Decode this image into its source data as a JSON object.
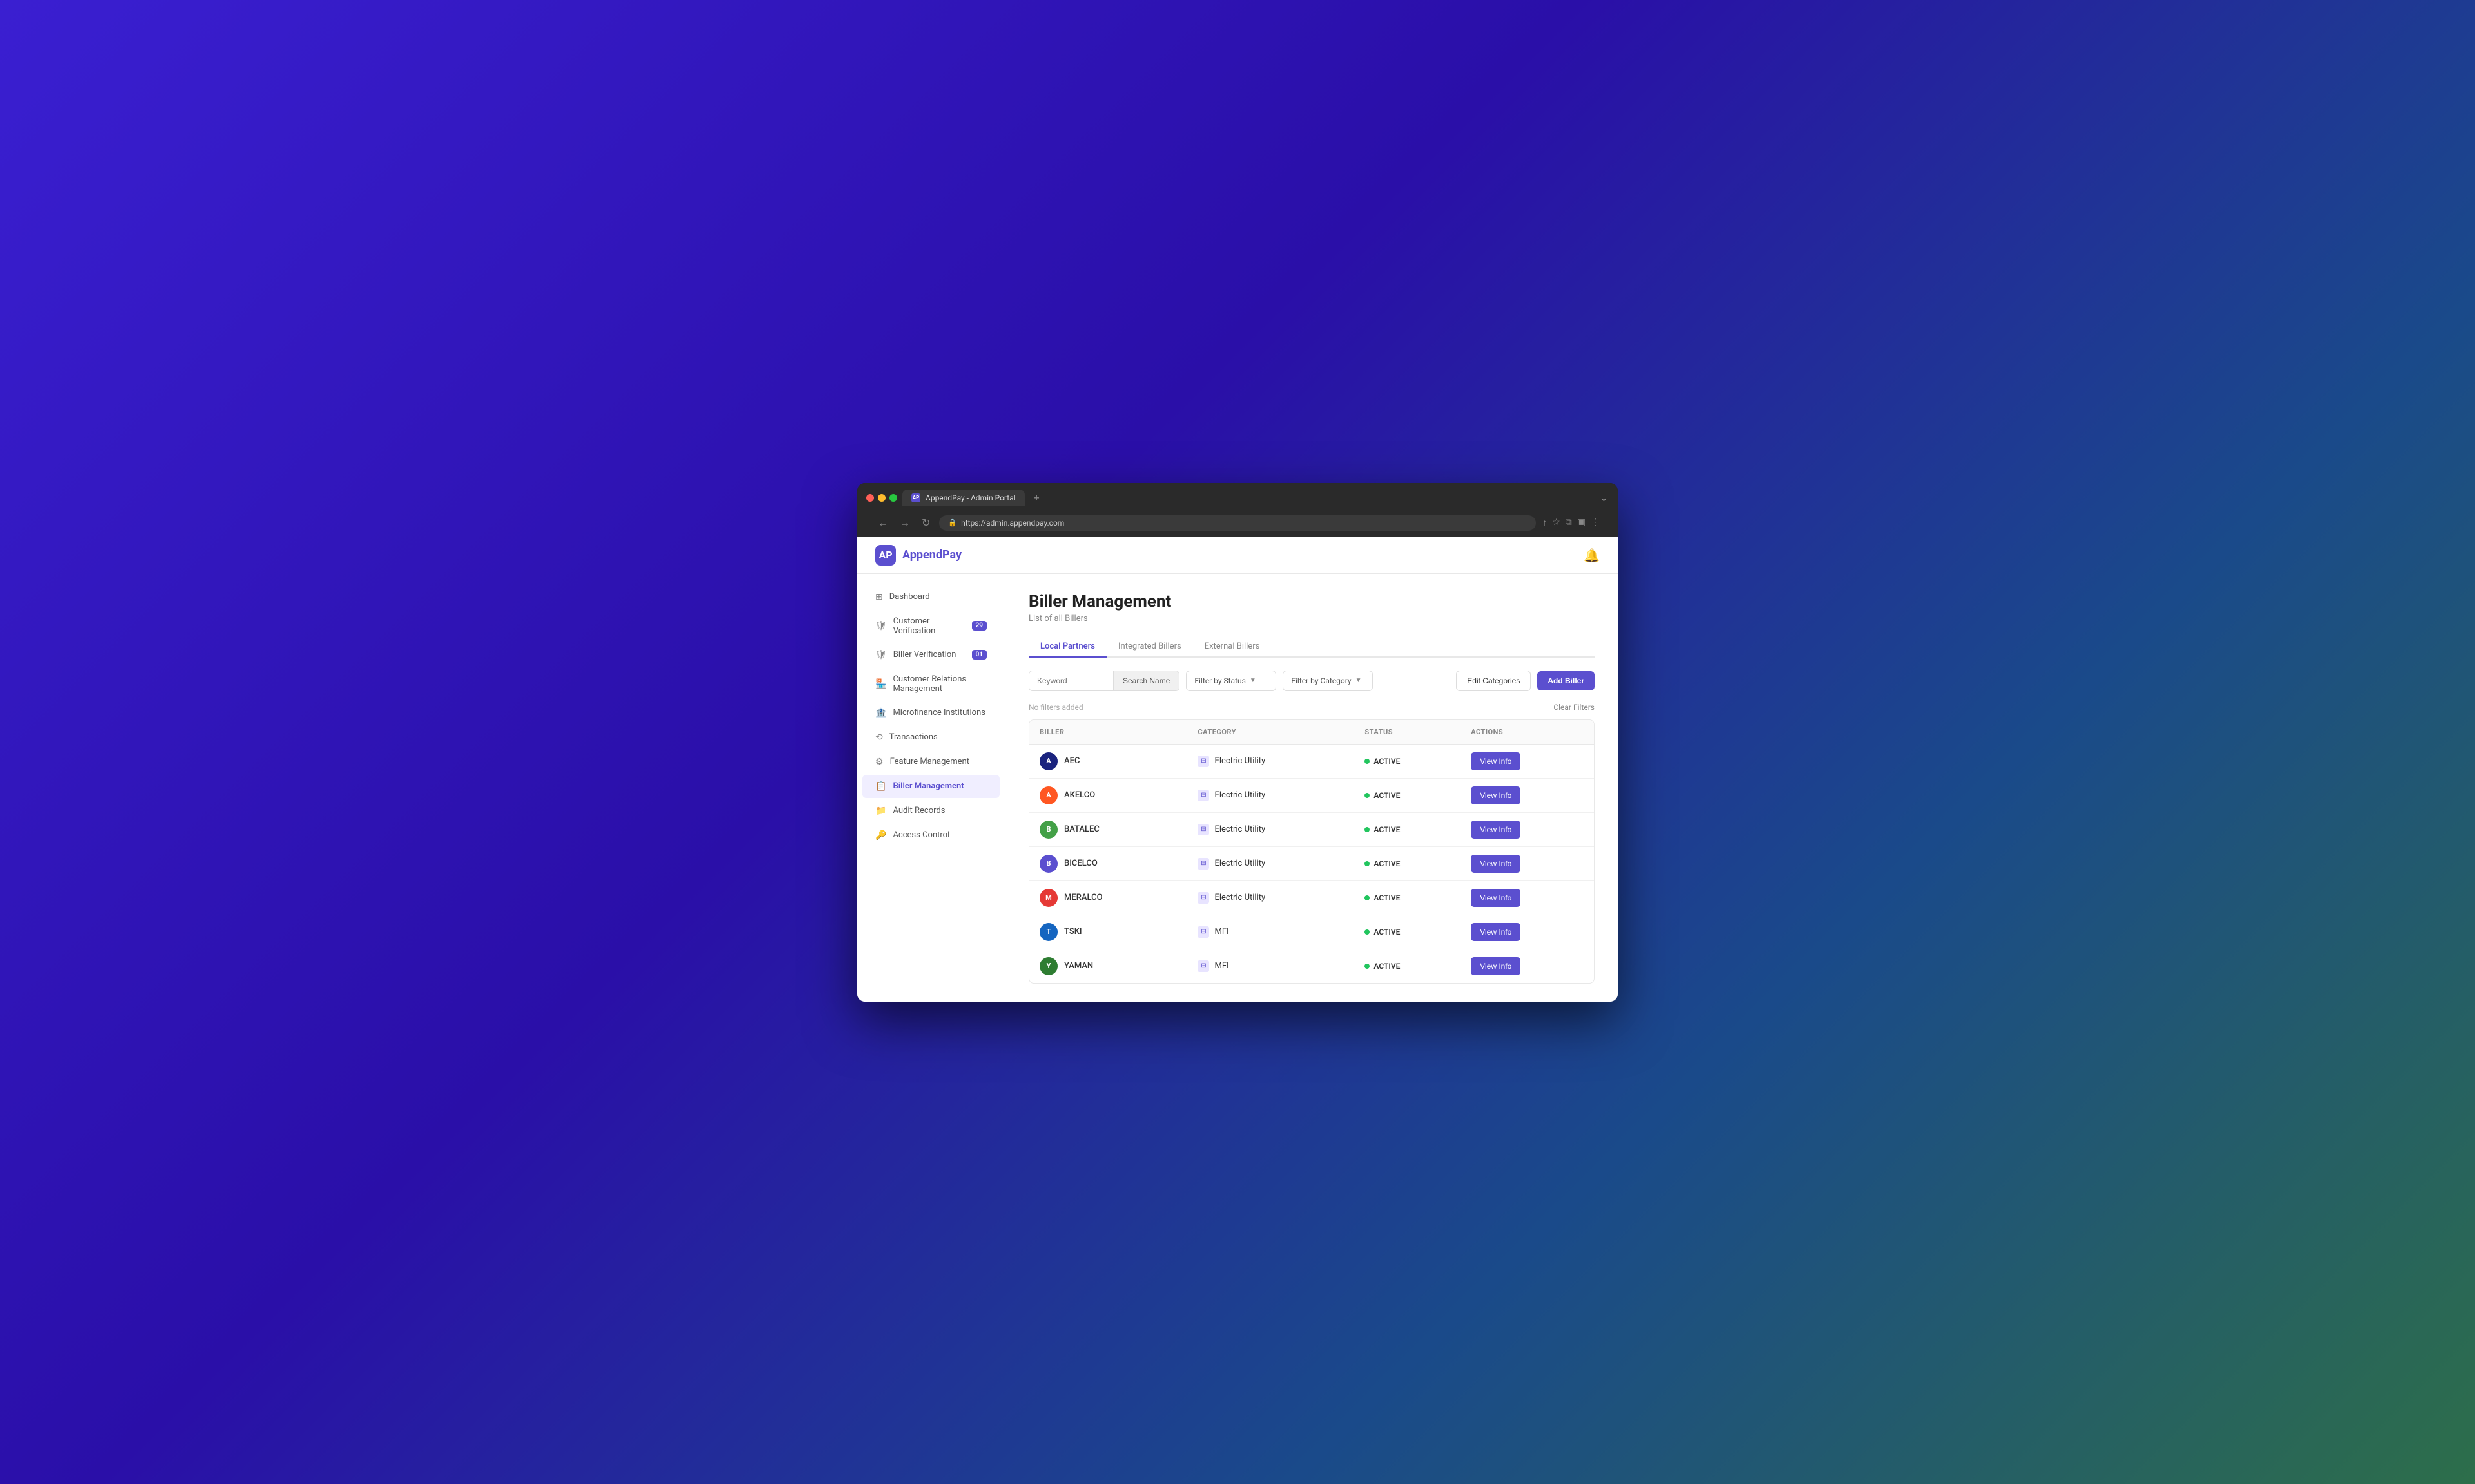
{
  "browser": {
    "tab_title": "AppendPay - Admin Portal",
    "url": "https://admin.appendpay.com",
    "tab_plus": "+",
    "nav_back": "←",
    "nav_forward": "→",
    "nav_refresh": "↻"
  },
  "app": {
    "logo_text": "AppendPay",
    "logo_short": "AP",
    "bell_icon": "🔔"
  },
  "sidebar": {
    "items": [
      {
        "id": "dashboard",
        "label": "Dashboard",
        "icon": "⊞",
        "badge": null
      },
      {
        "id": "customer-verification",
        "label": "Customer Verification",
        "icon": "🛡",
        "badge": "29"
      },
      {
        "id": "biller-verification",
        "label": "Biller Verification",
        "icon": "🛡",
        "badge": "01"
      },
      {
        "id": "customer-relations",
        "label": "Customer Relations Management",
        "icon": "🏪",
        "badge": null
      },
      {
        "id": "microfinance",
        "label": "Microfinance Institutions",
        "icon": "🏦",
        "badge": null
      },
      {
        "id": "transactions",
        "label": "Transactions",
        "icon": "⟲",
        "badge": null
      },
      {
        "id": "feature-management",
        "label": "Feature Management",
        "icon": "⚙",
        "badge": null
      },
      {
        "id": "biller-management",
        "label": "Biller Management",
        "icon": "📋",
        "badge": null,
        "active": true
      },
      {
        "id": "audit-records",
        "label": "Audit Records",
        "icon": "📁",
        "badge": null
      },
      {
        "id": "access-control",
        "label": "Access Control",
        "icon": "🔑",
        "badge": null
      }
    ]
  },
  "main": {
    "page_title": "Biller Management",
    "page_subtitle": "List of all Billers",
    "tabs": [
      {
        "id": "local-partners",
        "label": "Local Partners",
        "active": true
      },
      {
        "id": "integrated-billers",
        "label": "Integrated Billers",
        "active": false
      },
      {
        "id": "external-billers",
        "label": "External Billers",
        "active": false
      }
    ],
    "filters": {
      "search_placeholder": "Keyword",
      "search_btn_label": "Search Name",
      "filter_status_label": "Filter by Status",
      "filter_category_label": "Filter by Category",
      "edit_categories_label": "Edit Categories",
      "add_biller_label": "Add Biller",
      "no_filters_text": "No filters added",
      "clear_filters_label": "Clear Filters"
    },
    "table": {
      "headers": [
        "BILLER",
        "CATEGORY",
        "STATUS",
        "ACTIONS"
      ],
      "rows": [
        {
          "id": "aec",
          "name": "AEC",
          "logo_class": "logo-aec",
          "logo_text": "A",
          "category": "Electric Utility",
          "status": "ACTIVE",
          "action_label": "View Info"
        },
        {
          "id": "akelco",
          "name": "AKELCO",
          "logo_class": "logo-akelco",
          "logo_text": "A",
          "category": "Electric Utility",
          "status": "ACTIVE",
          "action_label": "View Info"
        },
        {
          "id": "batalec",
          "name": "BATALEC",
          "logo_class": "logo-batalec",
          "logo_text": "B",
          "category": "Electric Utility",
          "status": "ACTIVE",
          "action_label": "View Info"
        },
        {
          "id": "bicelco",
          "name": "BICELCO",
          "logo_class": "logo-bicelco",
          "logo_text": "B",
          "category": "Electric Utility",
          "status": "ACTIVE",
          "action_label": "View Info"
        },
        {
          "id": "meralco",
          "name": "MERALCO",
          "logo_class": "logo-meralco",
          "logo_text": "M",
          "category": "Electric Utility",
          "status": "ACTIVE",
          "action_label": "View Info"
        },
        {
          "id": "tski",
          "name": "TSKI",
          "logo_class": "logo-tski",
          "logo_text": "T",
          "category": "MFI",
          "status": "ACTIVE",
          "action_label": "View Info"
        },
        {
          "id": "yaman",
          "name": "YAMAN",
          "logo_class": "logo-yaman",
          "logo_text": "Y",
          "category": "MFI",
          "status": "ACTIVE",
          "action_label": "View Info"
        }
      ]
    }
  }
}
